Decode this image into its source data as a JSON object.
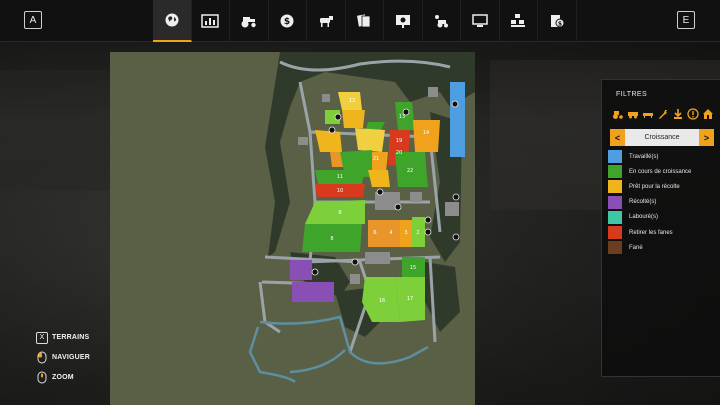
{
  "topbar": {
    "left_key": "A",
    "right_key": "E",
    "tabs": [
      {
        "icon": "globe-icon",
        "active": true
      },
      {
        "icon": "stats-chart-icon",
        "active": false
      },
      {
        "icon": "tractor-icon",
        "active": false
      },
      {
        "icon": "money-icon",
        "active": false
      },
      {
        "icon": "cow-icon",
        "active": false
      },
      {
        "icon": "contracts-icon",
        "active": false
      },
      {
        "icon": "tutorial-icon",
        "active": false
      },
      {
        "icon": "workers-icon",
        "active": false
      },
      {
        "icon": "computer-icon",
        "active": false
      },
      {
        "icon": "production-icon",
        "active": false
      },
      {
        "icon": "finance-icon",
        "active": false
      }
    ]
  },
  "filters": {
    "title": "FILTRES",
    "filter_icons": [
      "tractor-filter-icon",
      "trailer-filter-icon",
      "tool-filter-icon",
      "wrench-filter-icon",
      "sell-point-filter-icon",
      "info-filter-icon",
      "farmhouse-filter-icon"
    ],
    "selector": {
      "prev": "<",
      "value": "Croissance",
      "next": ">"
    },
    "legend": [
      {
        "label": "Travaillé(s)",
        "color": "#4f9fe0"
      },
      {
        "label": "En cours de croissance",
        "color": "#3ea52a"
      },
      {
        "label": "Prêt pour la récolte",
        "color": "#f0b41c"
      },
      {
        "label": "Récolté(s)",
        "color": "#8a4fb5"
      },
      {
        "label": "Labouré(s)",
        "color": "#3fc7a4"
      },
      {
        "label": "Retirer les fanes",
        "color": "#d83a1e"
      },
      {
        "label": "Fané",
        "color": "#6b3e22"
      }
    ]
  },
  "controls": [
    {
      "key": "X",
      "label": "TERRAINS",
      "icon": null
    },
    {
      "key": null,
      "label": "NAVIGUER",
      "icon": "mouse-move-icon"
    },
    {
      "key": null,
      "label": "ZOOM",
      "icon": "mouse-wheel-icon"
    }
  ],
  "map": {
    "fields": [
      {
        "id": "13",
        "color": "#3ea52a"
      },
      {
        "id": "14",
        "color": "#f0a21c"
      },
      {
        "id": "21",
        "color": "#3ea52a"
      },
      {
        "id": "22",
        "color": "#3ea52a"
      },
      {
        "id": "11",
        "color": "#3ea52a"
      },
      {
        "id": "10",
        "color": "#d83a1e"
      },
      {
        "id": "9",
        "color": "#7ed03a"
      },
      {
        "id": "8",
        "color": "#3ea52a"
      },
      {
        "id": "6",
        "color": "#e8962a"
      },
      {
        "id": "4",
        "color": "#e8962a"
      },
      {
        "id": "3",
        "color": "#f0a21c"
      },
      {
        "id": "2",
        "color": "#7ed03a"
      },
      {
        "id": "15",
        "color": "#3ea52a"
      },
      {
        "id": "16",
        "color": "#7ed03a"
      },
      {
        "id": "17",
        "color": "#7ed03a"
      },
      {
        "id": "19",
        "color": "#f0a21c"
      },
      {
        "id": "20",
        "color": "#d83a1e"
      },
      {
        "id": "12",
        "color": "#f0d040"
      }
    ]
  }
}
